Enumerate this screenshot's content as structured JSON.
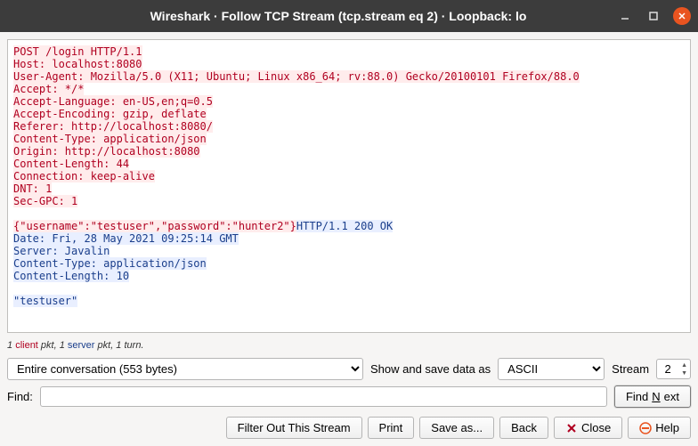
{
  "title": "Wireshark · Follow TCP Stream (tcp.stream eq 2) · Loopback: lo",
  "request": "POST /login HTTP/1.1\nHost: localhost:8080\nUser-Agent: Mozilla/5.0 (X11; Ubuntu; Linux x86_64; rv:88.0) Gecko/20100101 Firefox/88.0\nAccept: */*\nAccept-Language: en-US,en;q=0.5\nAccept-Encoding: gzip, deflate\nReferer: http://localhost:8080/\nContent-Type: application/json\nOrigin: http://localhost:8080\nContent-Length: 44\nConnection: keep-alive\nDNT: 1\nSec-GPC: 1\n\n{\"username\":\"testuser\",\"password\":\"hunter2\"}",
  "response": "HTTP/1.1 200 OK\nDate: Fri, 28 May 2021 09:25:14 GMT\nServer: Javalin\nContent-Type: application/json\nContent-Length: 10\n\n\"testuser\"",
  "stats": {
    "client_count": "1",
    "client_word": "client",
    "mid1": " pkt, ",
    "server_count": "1",
    "server_word": "server",
    "tail": " pkt, 1 turn."
  },
  "conversation_selected": "Entire conversation (553 bytes)",
  "show_save_label": "Show and save data as",
  "encoding_selected": "ASCII",
  "stream_label": "Stream",
  "stream_value": "2",
  "find_label": "Find:",
  "find_value": "",
  "buttons": {
    "find_next": "Find Next",
    "filter_out": "Filter Out This Stream",
    "print": "Print",
    "save_as": "Save as...",
    "back": "Back",
    "close": "Close",
    "help": "Help"
  }
}
